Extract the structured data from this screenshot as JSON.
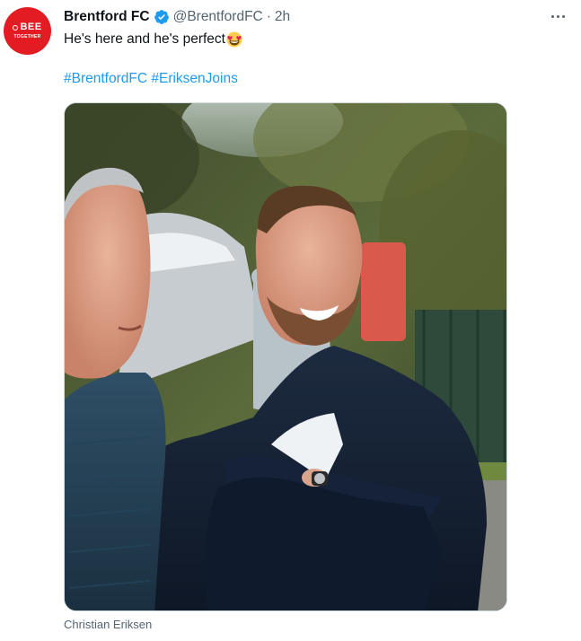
{
  "tweet": {
    "author": {
      "name": "Brentford FC",
      "handle": "@BrentfordFC",
      "separator": "·",
      "time": "2h",
      "verified": true,
      "avatar": {
        "line1": "BEE",
        "line2": "TOGETHER",
        "icon": "bee-together-logo"
      }
    },
    "text": "He's here and he's perfect",
    "emoji": "heart-eyes-emoji",
    "hashtags": [
      "#BrentfordFC",
      "#EriksenJoins"
    ],
    "media": {
      "alt": "Photo of two men smiling outdoors in winter jackets"
    },
    "caption": "Christian Eriksen",
    "more_icon": "more-horizontal-icon"
  },
  "colors": {
    "accent": "#1d9bf0",
    "brand": "#e31b23",
    "secondary_text": "#536471",
    "primary_text": "#0f1419"
  }
}
